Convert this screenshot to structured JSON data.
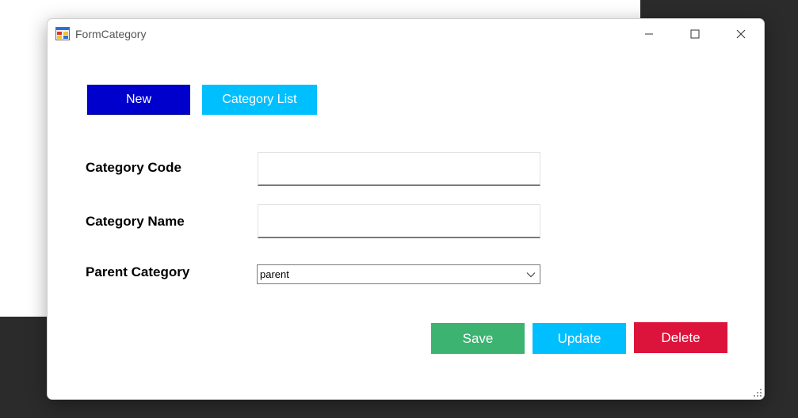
{
  "window": {
    "title": "FormCategory"
  },
  "toolbar": {
    "new_label": "New",
    "category_list_label": "Category List"
  },
  "form": {
    "category_code_label": "Category Code",
    "category_code_value": "",
    "category_name_label": "Category Name",
    "category_name_value": "",
    "parent_category_label": "Parent Category",
    "parent_category_selected": "parent"
  },
  "actions": {
    "save_label": "Save",
    "update_label": "Update",
    "delete_label": "Delete"
  },
  "colors": {
    "new_button": "#0000cd",
    "category_list_button": "#00bfff",
    "save_button": "#3cb371",
    "update_button": "#00bfff",
    "delete_button": "#dc143c"
  },
  "icons": {
    "app": "form-app-icon",
    "minimize": "minimize-icon",
    "maximize": "maximize-icon",
    "close": "close-icon",
    "dropdown": "chevron-down-icon",
    "resize": "resize-grip-icon"
  }
}
